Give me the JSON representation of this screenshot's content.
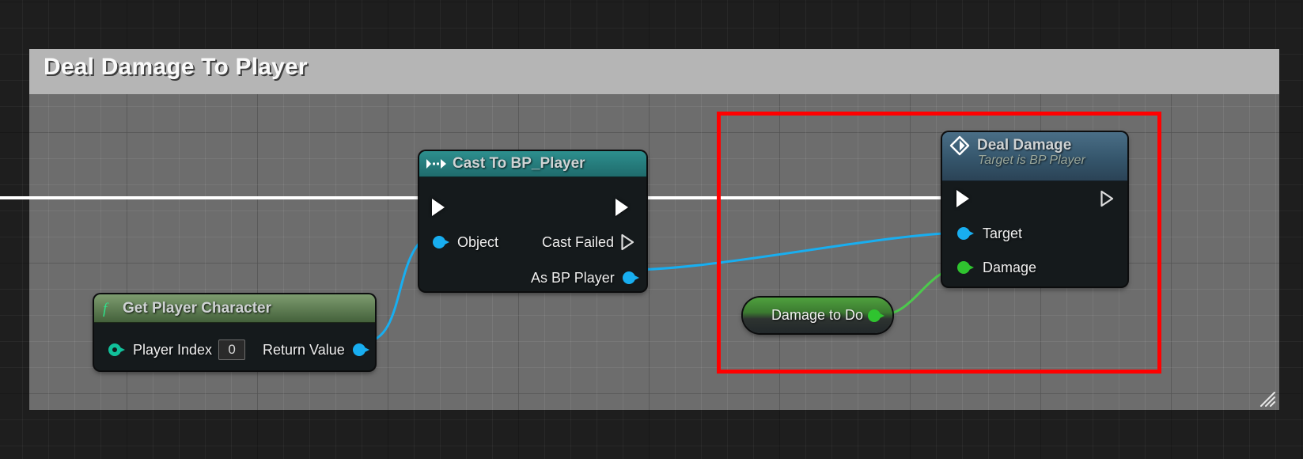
{
  "editor": {
    "type": "blueprint-graph",
    "comment": {
      "title": "Deal Damage To Player",
      "header_color": "#b5b5b5",
      "body_color": "#737373"
    },
    "selection_rect": {
      "color": "#ff0000",
      "label": "selection-highlight"
    }
  },
  "nodes": {
    "cast": {
      "title": "Cast To BP_Player",
      "icon": "cast-icon",
      "header_color": "#2d8f8e",
      "inputs": [
        {
          "name": "exec-in",
          "label": "",
          "pin": "exec",
          "color": "#ffffff"
        },
        {
          "name": "object-in",
          "label": "Object",
          "pin": "data",
          "color": "#18aef0"
        }
      ],
      "outputs": [
        {
          "name": "exec-out",
          "label": "",
          "pin": "exec",
          "color": "#ffffff"
        },
        {
          "name": "cast-failed-out",
          "label": "Cast Failed",
          "pin": "exec-hollow",
          "color": "#ffffff"
        },
        {
          "name": "as-bp-player-out",
          "label": "As BP Player",
          "pin": "data",
          "color": "#18aef0"
        }
      ]
    },
    "deal_damage": {
      "title": "Deal Damage",
      "subtitle": "Target is BP Player",
      "icon": "diamond-icon",
      "header_color": "#4a6e86",
      "inputs": [
        {
          "name": "exec-in",
          "label": "",
          "pin": "exec",
          "color": "#ffffff"
        },
        {
          "name": "target-in",
          "label": "Target",
          "pin": "data",
          "color": "#18aef0"
        },
        {
          "name": "damage-in",
          "label": "Damage",
          "pin": "data",
          "color": "#2fc42f"
        }
      ],
      "outputs": [
        {
          "name": "exec-out",
          "label": "",
          "pin": "exec-hollow",
          "color": "#ffffff"
        }
      ]
    },
    "get_player_character": {
      "title": "Get Player Character",
      "icon": "function-icon",
      "header_color": "#7d9c6f",
      "inputs": [
        {
          "name": "player-index-in",
          "label": "Player Index",
          "pin": "data-ring",
          "color": "#11c09a",
          "value": "0"
        }
      ],
      "outputs": [
        {
          "name": "return-value-out",
          "label": "Return Value",
          "pin": "data",
          "color": "#18aef0"
        }
      ]
    },
    "damage_to_do": {
      "title": "Damage to Do",
      "header_color": "#4fa03e",
      "outputs": [
        {
          "name": "value-out",
          "label": "",
          "pin": "data",
          "color": "#2fc42f"
        }
      ]
    }
  },
  "wires": [
    {
      "name": "exec-into-cast",
      "color": "#ffffff",
      "kind": "exec"
    },
    {
      "name": "cast-exec-to-dealdamage",
      "color": "#ffffff",
      "kind": "exec"
    },
    {
      "name": "getplayer-return-to-cast-object",
      "color": "#18aef0",
      "kind": "data"
    },
    {
      "name": "asbpplayer-to-target",
      "color": "#18aef0",
      "kind": "data"
    },
    {
      "name": "damagetodo-to-damage",
      "color": "#4cc94c",
      "kind": "data"
    }
  ]
}
